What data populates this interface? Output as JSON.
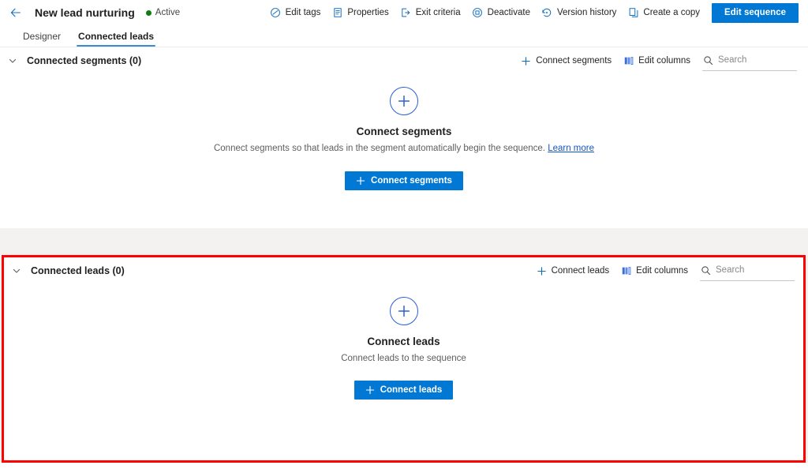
{
  "header": {
    "back_icon": "arrow-left-icon",
    "title": "New lead nurturing",
    "status_label": "Active",
    "status_color": "#107c10",
    "commands": [
      {
        "label": "Edit tags",
        "icon": "tag-icon"
      },
      {
        "label": "Properties",
        "icon": "properties-icon"
      },
      {
        "label": "Exit criteria",
        "icon": "exit-icon"
      },
      {
        "label": "Deactivate",
        "icon": "deactivate-icon"
      },
      {
        "label": "Version history",
        "icon": "history-icon"
      },
      {
        "label": "Create a copy",
        "icon": "copy-icon"
      }
    ],
    "primary_button": "Edit sequence"
  },
  "tabs": [
    {
      "label": "Designer",
      "selected": false
    },
    {
      "label": "Connected leads",
      "selected": true
    }
  ],
  "segments_section": {
    "title": "Connected segments (0)",
    "chevron_icon": "chevron-down-icon",
    "actions": [
      {
        "label": "Connect segments",
        "icon": "plus-icon"
      },
      {
        "label": "Edit columns",
        "icon": "edit-columns-icon"
      }
    ],
    "search": {
      "placeholder": "Search",
      "value": "",
      "icon": "search-icon"
    },
    "empty_state": {
      "icon": "circle-plus-icon",
      "title": "Connect segments",
      "description": "Connect segments so that leads in the segment automatically begin the sequence.",
      "link_label": "Learn more",
      "button_label": "Connect segments"
    }
  },
  "leads_section": {
    "title": "Connected leads (0)",
    "chevron_icon": "chevron-down-icon",
    "actions": [
      {
        "label": "Connect leads",
        "icon": "plus-icon"
      },
      {
        "label": "Edit columns",
        "icon": "edit-columns-icon"
      }
    ],
    "search": {
      "placeholder": "Search",
      "value": "",
      "icon": "search-icon"
    },
    "empty_state": {
      "icon": "circle-plus-icon",
      "title": "Connect leads",
      "description": "Connect leads to the sequence",
      "button_label": "Connect leads"
    }
  },
  "annotation": {
    "highlight_color": "#ff0000",
    "target": "leads_section"
  },
  "theme": {
    "accent": "#0078d4",
    "icon_blue": "#0f6cbd",
    "link_blue": "#0f55c9",
    "tab_underline": "#3b8bd4",
    "page_bg": "#f3f2f1",
    "panel_bg": "#ffffff"
  }
}
